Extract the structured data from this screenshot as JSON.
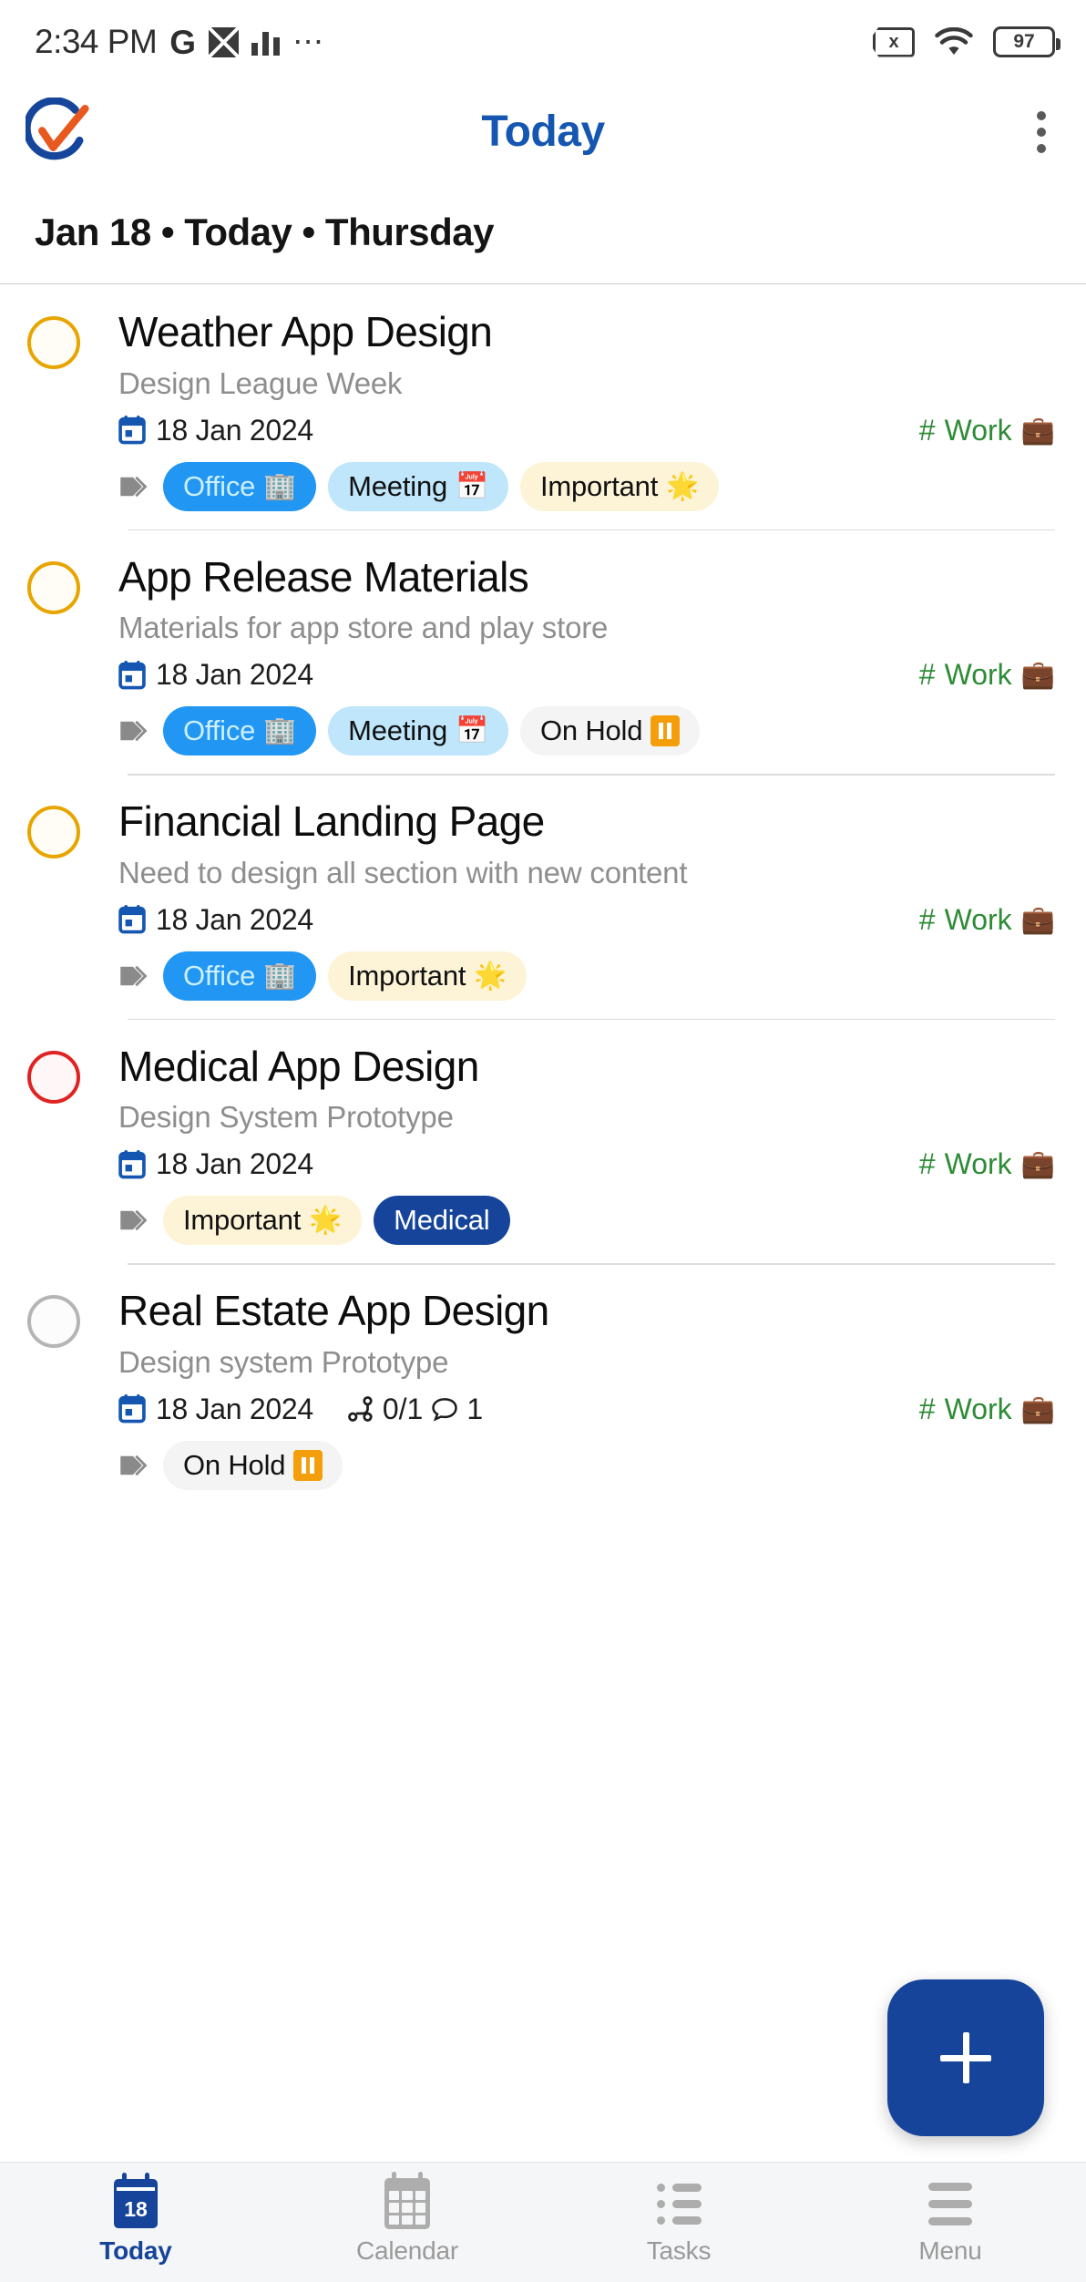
{
  "status_bar": {
    "time": "2:34 PM",
    "left_icons": [
      "google-icon",
      "app-badge-icon",
      "signal-bars-icon",
      "overflow-dots-icon"
    ],
    "g_label": "G",
    "overflow": "⋯",
    "sim_label": "x",
    "battery_level": "97",
    "right_icons": [
      "no-sim-icon",
      "wifi-icon",
      "battery-icon"
    ]
  },
  "app_bar": {
    "logo": "app-logo-icon",
    "title": "Today",
    "menu_icon": "kebab-menu-icon",
    "title_color": "#1557b0"
  },
  "date_header": {
    "text": "Jan 18 • Today • Thursday"
  },
  "tasks": [
    {
      "title": "Weather App Design",
      "description": "Design League Week",
      "date": "18 Jan 2024",
      "project": "Work",
      "project_prefix": "#",
      "project_emoji": "💼",
      "checkbox_state": "amber",
      "subtasks": null,
      "comments": null,
      "tags": [
        {
          "label": "Office",
          "emoji": "🏢",
          "style": "office"
        },
        {
          "label": "Meeting",
          "emoji": "📅",
          "style": "meeting"
        },
        {
          "label": "Important",
          "emoji": "🌟",
          "style": "important"
        }
      ]
    },
    {
      "title": "App Release Materials",
      "description": "Materials for app store and play store",
      "date": "18 Jan 2024",
      "project": "Work",
      "project_prefix": "#",
      "project_emoji": "💼",
      "checkbox_state": "amber",
      "subtasks": null,
      "comments": null,
      "tags": [
        {
          "label": "Office",
          "emoji": "🏢",
          "style": "office"
        },
        {
          "label": "Meeting",
          "emoji": "📅",
          "style": "meeting"
        },
        {
          "label": "On Hold",
          "emoji": "pause",
          "style": "onhold"
        }
      ]
    },
    {
      "title": "Financial Landing Page",
      "description": "Need to design all section with new content",
      "date": "18 Jan 2024",
      "project": "Work",
      "project_prefix": "#",
      "project_emoji": "💼",
      "checkbox_state": "amber",
      "subtasks": null,
      "comments": null,
      "tags": [
        {
          "label": "Office",
          "emoji": "🏢",
          "style": "office"
        },
        {
          "label": "Important",
          "emoji": "🌟",
          "style": "important"
        }
      ]
    },
    {
      "title": "Medical App Design",
      "description": "Design System Prototype",
      "date": "18 Jan 2024",
      "project": "Work",
      "project_prefix": "#",
      "project_emoji": "💼",
      "checkbox_state": "red",
      "subtasks": null,
      "comments": null,
      "tags": [
        {
          "label": "Important",
          "emoji": "🌟",
          "style": "important"
        },
        {
          "label": "Medical",
          "emoji": "",
          "style": "medical"
        }
      ]
    },
    {
      "title": "Real Estate App Design",
      "description": "Design system Prototype",
      "date": "18 Jan 2024",
      "project": "Work",
      "project_prefix": "#",
      "project_emoji": "💼",
      "checkbox_state": "grey",
      "subtasks": "0/1",
      "comments": "1",
      "tags": [
        {
          "label": "On Hold",
          "emoji": "pause",
          "style": "onhold"
        }
      ]
    }
  ],
  "fab": {
    "label": "+",
    "name": "add-task-button",
    "color": "#15449a"
  },
  "bottom_nav": {
    "items": [
      {
        "label": "Today",
        "icon": "calendar-day-icon",
        "active": true
      },
      {
        "label": "Calendar",
        "icon": "calendar-grid-icon",
        "active": false
      },
      {
        "label": "Tasks",
        "icon": "task-list-icon",
        "active": false
      },
      {
        "label": "Menu",
        "icon": "hamburger-menu-icon",
        "active": false
      }
    ]
  }
}
